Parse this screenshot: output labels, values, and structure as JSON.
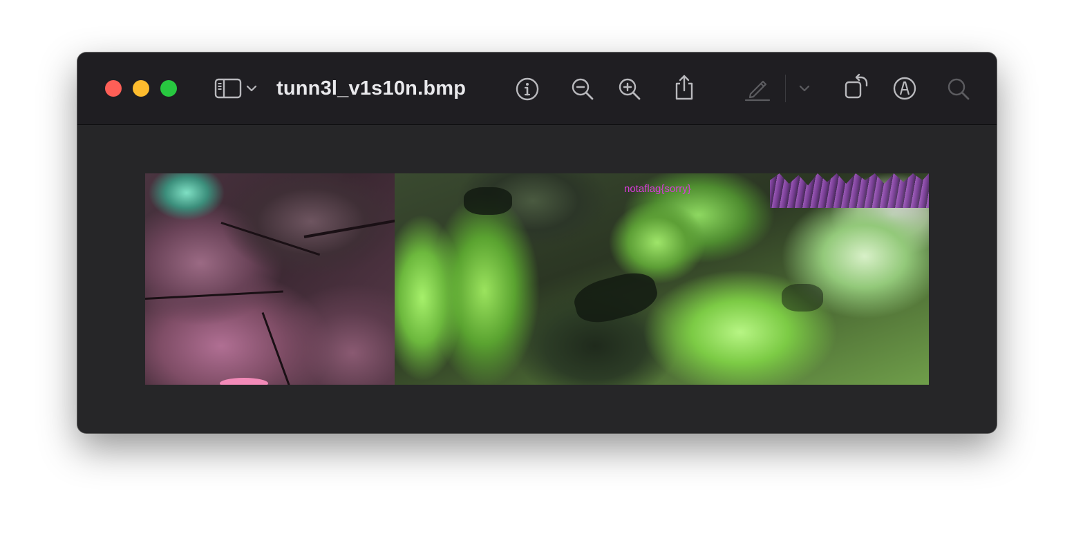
{
  "window": {
    "title": "tunn3l_v1s10n.bmp"
  },
  "traffic_lights": {
    "close": "#fe5f57",
    "minimize": "#febc2e",
    "maximize": "#28c840"
  },
  "toolbar": {
    "icons": [
      "sidebar-icon",
      "chevron-down-icon",
      "info-icon",
      "zoom-out-icon",
      "zoom-in-icon",
      "share-icon",
      "markup-pen-icon",
      "chevron-down-icon",
      "rotate-icon",
      "annotate-icon",
      "search-icon"
    ]
  },
  "image": {
    "overlay_text": "notaflag{sorry}"
  },
  "colors": {
    "titlebar": "#1f1e22",
    "content": "#262628",
    "title_text": "#e9e9ec",
    "icon": "#b9b9bd",
    "icon_disabled": "#5c5c60",
    "overlay_text": "#d93bd9"
  }
}
